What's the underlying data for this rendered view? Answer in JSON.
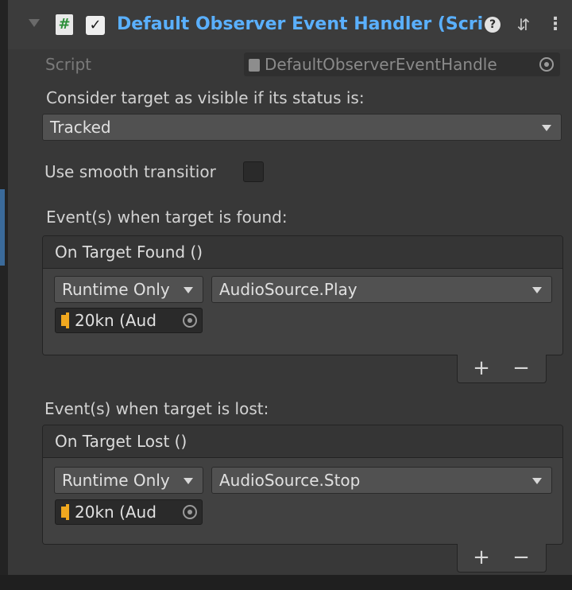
{
  "header": {
    "title": "Default Observer Event Handler (Scrip",
    "script_icon_glyph": "#",
    "enabled_glyph": "✓",
    "help_glyph": "?",
    "presets_glyph": "⇵",
    "menu_glyph": "⋮",
    "title_color": "#5ab0ff"
  },
  "script_row": {
    "label": "Script",
    "value": "DefaultObserverEventHandle"
  },
  "visibility": {
    "label": "Consider target as visible if its status is:",
    "selected": "Tracked"
  },
  "smooth": {
    "label": "Use smooth transitior",
    "checked": false
  },
  "found": {
    "label": "Event(s) when target is found:",
    "header": "On Target Found ()",
    "runtime": "Runtime Only",
    "function": "AudioSource.Play",
    "object": "20kn (Aud",
    "plus": "+",
    "minus": "−"
  },
  "lost": {
    "label": "Event(s) when target is lost:",
    "header": "On Target Lost ()",
    "runtime": "Runtime Only",
    "function": "AudioSource.Stop",
    "object": "20kn (Aud",
    "plus": "+",
    "minus": "−"
  },
  "icons": {
    "foldout": "triangle-down-icon",
    "script": "csharp-script-icon",
    "audio": "audio-source-icon",
    "target": "object-picker-icon"
  }
}
